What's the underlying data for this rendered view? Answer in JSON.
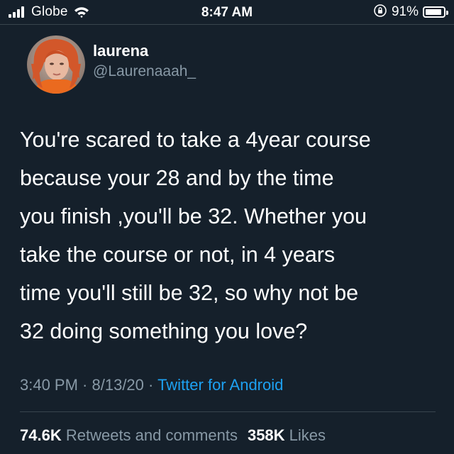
{
  "status_bar": {
    "carrier": "Globe",
    "time": "8:47 AM",
    "battery_percent": "91%",
    "battery_level": 0.91,
    "icons": [
      "signal-icon",
      "wifi-icon",
      "orientation-lock-icon",
      "battery-icon"
    ]
  },
  "tweet": {
    "author": {
      "display_name": "laurena",
      "handle": "@Laurenaaah_"
    },
    "text_lines": [
      "You're scared to take a 4year course",
      "because your 28 and by the time",
      "you finish ,you'll be 32. Whether you",
      "take the course or not, in 4 years",
      "time you'll still be 32, so why not be",
      "32 doing something you love?"
    ],
    "time": "3:40 PM",
    "separator": " · ",
    "date": "8/13/20",
    "source": "Twitter for Android",
    "retweets_count": "74.6K",
    "retweets_label": "Retweets and comments",
    "likes_count": "358K",
    "likes_label": "Likes"
  },
  "colors": {
    "background": "#15202b",
    "primary_text": "#ffffff",
    "secondary_text": "#8899a6",
    "link": "#1da1f2",
    "divider": "#38444d"
  }
}
